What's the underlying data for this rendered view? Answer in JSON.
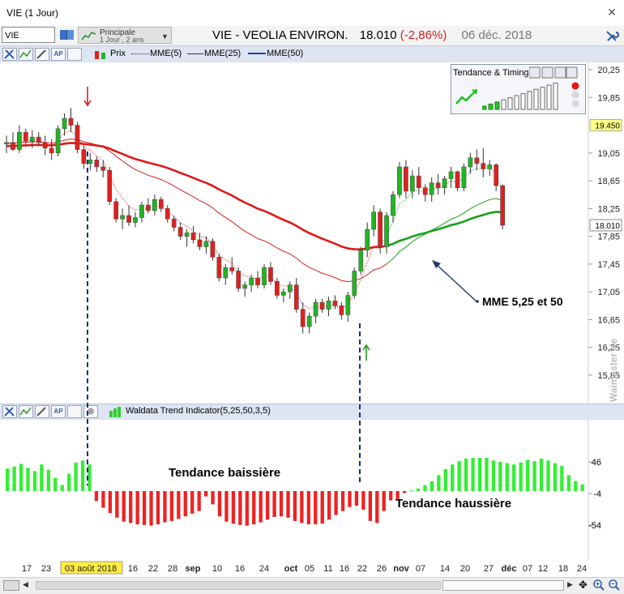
{
  "window": {
    "title": "VIE (1 Jour)"
  },
  "toolbar": {
    "symbol_value": "VIE",
    "period_label": "Principale",
    "period_sub": "1 Jour , 2 ans",
    "stock_name": "VIE - VEOLIA ENVIRON.",
    "price": "18.010",
    "change": "(-2,86%)",
    "date": "06 déc. 2018"
  },
  "legend": {
    "prix": "Prix",
    "mme5": "MME(5)",
    "mme25": "MME(25)",
    "mme50": "MME(50)"
  },
  "timing_panel": {
    "title": "Tendance & Timing"
  },
  "indicator": {
    "title": "Waldata Trend Indicator(5,25,50,3,5)"
  },
  "annotations": {
    "mme": "MME 5,25 et 50",
    "baissiere": "Tendance baissière",
    "haussiere": "Tendance haussière",
    "watermark": "Waimaster Xe"
  },
  "price_axis": {
    "ticks": [
      "20,25",
      "19,85",
      "19,05",
      "18,65",
      "18,25",
      "17,85",
      "17,45",
      "17,05",
      "16,65",
      "16,25",
      "15,85"
    ],
    "marker_high": "19.450",
    "marker_last": "18.010"
  },
  "indicator_axis": {
    "ticks": [
      "46",
      "-4",
      "-54"
    ]
  },
  "time_axis": {
    "labels": [
      "17",
      "23",
      "03 août 2018",
      "16",
      "22",
      "28",
      "sep",
      "10",
      "16",
      "24",
      "oct",
      "05",
      "11",
      "16",
      "22",
      "26",
      "nov",
      "07",
      "14",
      "20",
      "27",
      "déc",
      "07",
      "12",
      "18",
      "24"
    ]
  },
  "colors": {
    "up": "#22b422",
    "down": "#e02020",
    "ema5": "#1a1a1a",
    "ema25": "#d42020",
    "ema50": "#e01818",
    "ema_green": "#18a018",
    "bull": "#33ee33",
    "bear": "#ee2222",
    "annot_green": "#1a8a1a",
    "annot_red": "#c81414"
  },
  "chart_data": {
    "type": "candlestick",
    "y_range": [
      15.6,
      20.45
    ],
    "candles": [
      [
        19.18,
        19.3,
        19.05,
        19.2
      ],
      [
        19.2,
        19.35,
        19.08,
        19.1
      ],
      [
        19.1,
        19.45,
        19.05,
        19.35
      ],
      [
        19.35,
        19.4,
        19.15,
        19.22
      ],
      [
        19.22,
        19.38,
        19.12,
        19.28
      ],
      [
        19.28,
        19.35,
        19.15,
        19.2
      ],
      [
        19.2,
        19.3,
        19.02,
        19.12
      ],
      [
        19.12,
        19.25,
        18.95,
        19.05
      ],
      [
        19.05,
        19.45,
        19.0,
        19.4
      ],
      [
        19.4,
        19.62,
        19.3,
        19.55
      ],
      [
        19.55,
        19.7,
        19.35,
        19.45
      ],
      [
        19.45,
        19.5,
        19.05,
        19.1
      ],
      [
        19.1,
        19.15,
        18.82,
        18.9
      ],
      [
        18.9,
        19.05,
        18.8,
        18.95
      ],
      [
        18.95,
        19.0,
        18.78,
        18.85
      ],
      [
        18.85,
        18.95,
        18.7,
        18.8
      ],
      [
        18.8,
        18.85,
        18.3,
        18.35
      ],
      [
        18.35,
        18.4,
        18.05,
        18.1
      ],
      [
        18.1,
        18.25,
        17.95,
        18.15
      ],
      [
        18.15,
        18.3,
        18.0,
        18.05
      ],
      [
        18.05,
        18.2,
        17.98,
        18.12
      ],
      [
        18.12,
        18.35,
        18.05,
        18.3
      ],
      [
        18.3,
        18.4,
        18.18,
        18.22
      ],
      [
        18.22,
        18.45,
        18.15,
        18.38
      ],
      [
        18.38,
        18.42,
        18.2,
        18.25
      ],
      [
        18.25,
        18.3,
        18.05,
        18.1
      ],
      [
        18.1,
        18.15,
        17.92,
        17.98
      ],
      [
        17.98,
        18.05,
        17.8,
        17.85
      ],
      [
        17.85,
        17.95,
        17.7,
        17.9
      ],
      [
        17.9,
        18.0,
        17.75,
        17.8
      ],
      [
        17.8,
        17.9,
        17.65,
        17.7
      ],
      [
        17.7,
        17.85,
        17.6,
        17.78
      ],
      [
        17.78,
        17.82,
        17.5,
        17.55
      ],
      [
        17.55,
        17.6,
        17.2,
        17.25
      ],
      [
        17.25,
        17.45,
        17.15,
        17.4
      ],
      [
        17.4,
        17.55,
        17.3,
        17.35
      ],
      [
        17.35,
        17.4,
        17.05,
        17.1
      ],
      [
        17.1,
        17.2,
        16.98,
        17.15
      ],
      [
        17.15,
        17.3,
        17.05,
        17.25
      ],
      [
        17.25,
        17.35,
        17.1,
        17.15
      ],
      [
        17.15,
        17.45,
        17.1,
        17.4
      ],
      [
        17.4,
        17.48,
        17.15,
        17.2
      ],
      [
        17.2,
        17.25,
        16.95,
        17.0
      ],
      [
        17.0,
        17.1,
        16.9,
        17.05
      ],
      [
        17.05,
        17.2,
        16.95,
        17.15
      ],
      [
        17.15,
        17.25,
        16.75,
        16.8
      ],
      [
        16.8,
        16.9,
        16.45,
        16.55
      ],
      [
        16.55,
        16.75,
        16.45,
        16.7
      ],
      [
        16.7,
        16.95,
        16.6,
        16.9
      ],
      [
        16.9,
        16.95,
        16.75,
        16.8
      ],
      [
        16.8,
        16.98,
        16.7,
        16.92
      ],
      [
        16.92,
        17.0,
        16.8,
        16.85
      ],
      [
        16.85,
        16.9,
        16.65,
        16.72
      ],
      [
        16.72,
        17.05,
        16.62,
        17.0
      ],
      [
        17.0,
        17.4,
        16.95,
        17.35
      ],
      [
        17.35,
        17.7,
        17.3,
        17.65
      ],
      [
        17.65,
        18.05,
        17.55,
        17.95
      ],
      [
        17.95,
        18.3,
        17.85,
        18.2
      ],
      [
        18.2,
        18.25,
        17.6,
        17.7
      ],
      [
        17.7,
        18.2,
        17.6,
        18.15
      ],
      [
        18.15,
        18.5,
        18.05,
        18.45
      ],
      [
        18.45,
        18.92,
        18.4,
        18.85
      ],
      [
        18.85,
        18.95,
        18.4,
        18.5
      ],
      [
        18.5,
        18.8,
        18.4,
        18.72
      ],
      [
        18.72,
        18.85,
        18.45,
        18.55
      ],
      [
        18.55,
        18.6,
        18.35,
        18.45
      ],
      [
        18.45,
        18.7,
        18.35,
        18.62
      ],
      [
        18.62,
        18.75,
        18.45,
        18.55
      ],
      [
        18.55,
        18.72,
        18.45,
        18.68
      ],
      [
        18.68,
        18.85,
        18.55,
        18.78
      ],
      [
        18.78,
        18.8,
        18.5,
        18.55
      ],
      [
        18.55,
        18.9,
        18.5,
        18.85
      ],
      [
        18.85,
        19.05,
        18.75,
        18.98
      ],
      [
        18.98,
        19.1,
        18.8,
        18.9
      ],
      [
        18.9,
        19.12,
        18.7,
        18.82
      ],
      [
        18.82,
        18.95,
        18.72,
        18.88
      ],
      [
        18.88,
        18.9,
        18.5,
        18.58
      ],
      [
        18.58,
        18.6,
        17.95,
        18.01
      ]
    ],
    "waldata": [
      34,
      37,
      41,
      35,
      30,
      40,
      32,
      20,
      9,
      26,
      43,
      46,
      40,
      -15,
      -25,
      -33,
      -40,
      -46,
      -48,
      -50,
      -51,
      -52,
      -50,
      -47,
      -45,
      -42,
      -38,
      -34,
      -30,
      -8,
      -20,
      -38,
      -46,
      -49,
      -51,
      -52,
      -50,
      -47,
      -43,
      -39,
      -38,
      -40,
      -45,
      -48,
      -50,
      -50,
      -49,
      -43,
      -36,
      -30,
      -24,
      -22,
      -28,
      -45,
      -48,
      -30,
      -14,
      -12,
      -3,
      1,
      4,
      9,
      15,
      24,
      33,
      40,
      45,
      49,
      50,
      50,
      50,
      46,
      44,
      42,
      40,
      43,
      47,
      45,
      49,
      46,
      42,
      38,
      24,
      15,
      10
    ],
    "date_labels": [
      "17",
      "23",
      "03 août 2018",
      "16",
      "22",
      "28",
      "sep",
      "10",
      "16",
      "24",
      "oct",
      "05",
      "11",
      "16",
      "22",
      "26",
      "nov",
      "07",
      "14",
      "20",
      "27",
      "déc",
      "07",
      "12",
      "18",
      "24"
    ]
  }
}
